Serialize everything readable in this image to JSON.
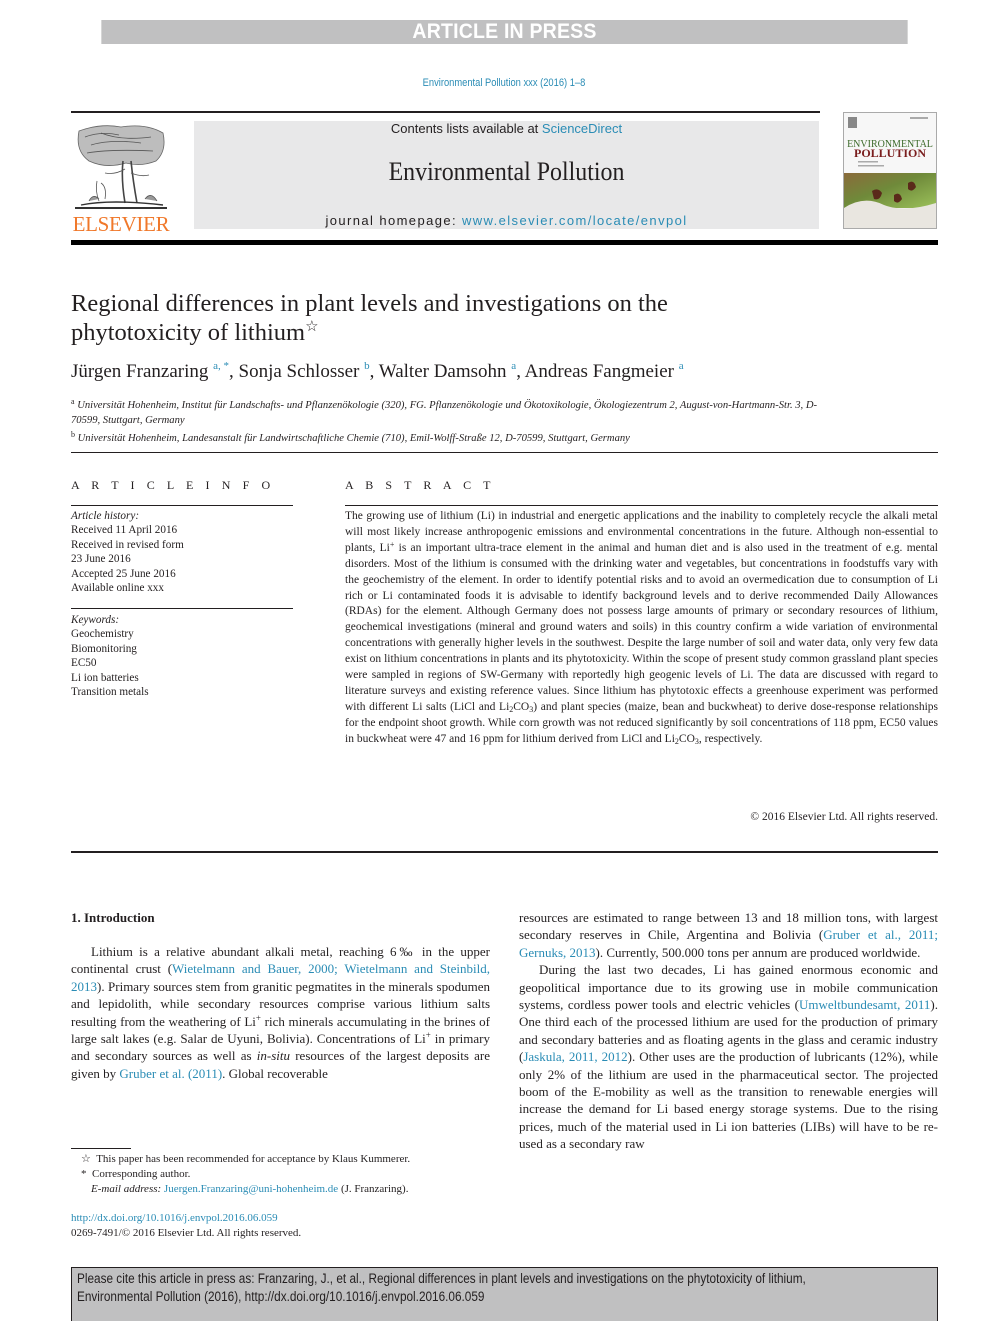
{
  "banner": {
    "press_status": "ARTICLE IN PRESS",
    "journal_reference": "Environmental Pollution xxx (2016) 1–8"
  },
  "header": {
    "publisher_wordmark": "ELSEVIER",
    "contents_prefix": "Contents lists available at ",
    "contents_link": "ScienceDirect",
    "journal_title": "Environmental Pollution",
    "homepage_prefix": "journal homepage: ",
    "homepage_link": "www.elsevier.com/locate/envpol",
    "cover_title_line1": "ENVIRONMENTAL",
    "cover_title_line2": "POLLUTION",
    "brand_color": "#f0782a",
    "link_color": "#2a8cb5"
  },
  "article": {
    "title_line1": "Regional differences in plant levels and investigations on the",
    "title_line2": "phytotoxicity of lithium",
    "title_mark": "☆",
    "authors": [
      {
        "name": "Jürgen Franzaring",
        "affil": "a, *"
      },
      {
        "name": "Sonja Schlosser",
        "affil": "b"
      },
      {
        "name": "Walter Damsohn",
        "affil": "a"
      },
      {
        "name": "Andreas Fangmeier",
        "affil": "a"
      }
    ],
    "affiliations": [
      {
        "mark": "a",
        "text": "Universität Hohenheim, Institut für Landschafts- und Pflanzenökologie (320), FG. Pflanzenökologie und Ökotoxikologie, Ökologiezentrum 2, August-von-Hartmann-Str. 3, D-70599, Stuttgart, Germany"
      },
      {
        "mark": "b",
        "text": "Universität Hohenheim, Landesanstalt für Landwirtschaftliche Chemie (710), Emil-Wolff-Straße 12, D-70599, Stuttgart, Germany"
      }
    ]
  },
  "article_info": {
    "label": "A R T I C L E   I N F O",
    "history_heading": "Article history:",
    "history": [
      "Received 11 April 2016",
      "Received in revised form",
      "23 June 2016",
      "Accepted 25 June 2016",
      "Available online xxx"
    ],
    "keywords_heading": "Keywords:",
    "keywords": [
      "Geochemistry",
      "Biomonitoring",
      "EC50",
      "Li ion batteries",
      "Transition metals"
    ]
  },
  "abstract": {
    "label": "A B S T R A C T",
    "part1": "The growing use of lithium (Li) in industrial and energetic applications and the inability to completely recycle the alkali metal will most likely increase anthropogenic emissions and environmental concentrations in the future. Although non-essential to plants, Li",
    "part2": " is an important ultra-trace element in the animal and human diet and is also used in the treatment of e.g. mental disorders. Most of the lithium is consumed with the drinking water and vegetables, but concentrations in foodstuffs vary with the geochemistry of the element. In order to identify potential risks and to avoid an overmedication due to consumption of Li rich or Li contaminated foods it is advisable to identify background levels and to derive recommended Daily Allowances (RDAs) for the element. Although Germany does not possess large amounts of primary or secondary resources of lithium, geochemical investigations (mineral and ground waters and soils) in this country confirm a wide variation of environmental concentrations with generally higher levels in the southwest. Despite the large number of soil and water data, only very few data exist on lithium concentrations in plants and its phytotoxicity. Within the scope of present study common grassland plant species were sampled in regions of SW-Germany with reportedly high geogenic levels of Li. The data are discussed with regard to literature surveys and existing reference values. Since lithium has phytotoxic effects a greenhouse experiment was performed with different Li salts (LiCl and Li",
    "part3": "CO",
    "part4": ") and plant species (maize, bean and buckwheat) to derive dose-response relationships for the endpoint shoot growth. While corn growth was not reduced significantly by soil concentrations of 118 ppm, EC50 values in buckwheat were 47 and 16 ppm for lithium derived from LiCl and Li",
    "part5": "CO",
    "part6": ", respectively.",
    "sup_plus": "+",
    "sub2": "2",
    "sub3": "3",
    "copyright": "© 2016 Elsevier Ltd. All rights reserved."
  },
  "introduction": {
    "heading": "1.  Introduction",
    "left": {
      "s1": "Lithium is a relative abundant alkali metal, reaching 6‰ in the upper continental crust (",
      "ref1": "Wietelmann and Bauer, 2000; Wietelmann and Steinbild, 2013",
      "s2": "). Primary sources stem from granitic pegmatites in the minerals spodumen and lepidolith, while secondary resources comprise various lithium salts resulting from the weathering of Li",
      "s3": " rich minerals accumulating in the brines of large salt lakes (e.g. Salar de Uyuni, Bolivia). Concentrations of Li",
      "s4": " in primary and secondary sources as well as ",
      "s4_italic": "in-situ",
      "s5": " resources of the largest deposits are given by ",
      "ref2": "Gruber et al. (2011)",
      "s6": ". Global recoverable",
      "sup_plus": "+"
    },
    "right": {
      "p1_s1": "resources are estimated to range between 13 and 18 million tons, with largest secondary reserves in Chile, Argentina and Bolivia (",
      "p1_ref": "Gruber et al., 2011; Gernuks, 2013",
      "p1_s2": "). Currently, 500.000 tons per annum are produced worldwide.",
      "p2_s1": "During the last two decades, Li has gained enormous economic and geopolitical importance due to its growing use in mobile communication systems, cordless power tools and electric vehicles (",
      "p2_ref1": "Umweltbundesamt, 2011",
      "p2_s2": "). One third each of the processed lithium are used for the production of primary and secondary batteries and as floating agents in the glass and ceramic industry (",
      "p2_ref2": "Jaskula, 2011, 2012",
      "p2_s3": "). Other uses are the production of lubricants (12%), while only 2% of the lithium are used in the pharmaceutical sector. The projected boom of the E-mobility as well as the transition to renewable energies will increase the demand for Li based energy storage systems. Due to the rising prices, much of the material used in Li ion batteries (LIBs) will have to be re-used as a secondary raw"
    }
  },
  "footnotes": {
    "star_mark": "☆",
    "star_note": "This paper has been recommended for acceptance by Klaus Kummerer.",
    "corr_mark": "*",
    "corr_note": "Corresponding author.",
    "email_label": "E-mail address: ",
    "email": "Juergen.Franzaring@uni-hohenheim.de",
    "email_suffix": " (J. Franzaring).",
    "doi": "http://dx.doi.org/10.1016/j.envpol.2016.06.059",
    "issn_copyright": "0269-7491/© 2016 Elsevier Ltd. All rights reserved."
  },
  "citation_box": {
    "line1": "Please cite this article in press as: Franzaring, J., et al., Regional differences in plant levels and investigations on the phytotoxicity of lithium,",
    "line2": "Environmental Pollution (2016), http://dx.doi.org/10.1016/j.envpol.2016.06.059"
  }
}
